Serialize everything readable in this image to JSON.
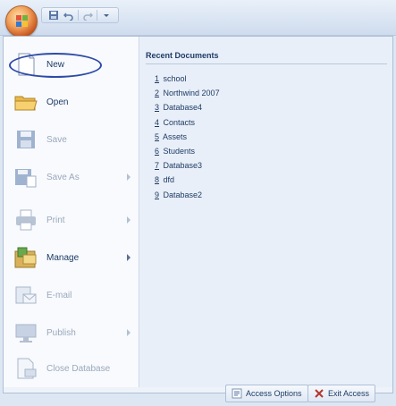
{
  "quick_access": {
    "items": [
      "save-icon",
      "undo-icon",
      "redo-icon",
      "customize-dropdown-icon"
    ]
  },
  "office_button": {
    "icon": "office-logo-icon"
  },
  "left_menu": {
    "items": [
      {
        "label": "New",
        "icon": "new-document-icon",
        "enabled": true,
        "submenu": false
      },
      {
        "label": "Open",
        "icon": "open-folder-icon",
        "enabled": true,
        "submenu": false
      },
      {
        "label": "Save",
        "icon": "save-disk-icon",
        "enabled": false,
        "submenu": false
      },
      {
        "label": "Save As",
        "icon": "save-as-icon",
        "enabled": false,
        "submenu": true
      },
      {
        "label": "Print",
        "icon": "printer-icon",
        "enabled": false,
        "submenu": true
      },
      {
        "label": "Manage",
        "icon": "manage-icon",
        "enabled": true,
        "submenu": true
      },
      {
        "label": "E-mail",
        "icon": "email-icon",
        "enabled": false,
        "submenu": false
      },
      {
        "label": "Publish",
        "icon": "publish-icon",
        "enabled": false,
        "submenu": true
      },
      {
        "label": "Close Database",
        "icon": "close-database-icon",
        "enabled": false,
        "submenu": false
      }
    ]
  },
  "recent": {
    "title": "Recent Documents",
    "items": [
      {
        "num": "1",
        "name": "school"
      },
      {
        "num": "2",
        "name": "Northwind 2007"
      },
      {
        "num": "3",
        "name": "Database4"
      },
      {
        "num": "4",
        "name": "Contacts"
      },
      {
        "num": "5",
        "name": "Assets"
      },
      {
        "num": "6",
        "name": "Students"
      },
      {
        "num": "7",
        "name": "Database3"
      },
      {
        "num": "8",
        "name": "dfd"
      },
      {
        "num": "9",
        "name": "Database2"
      }
    ]
  },
  "bottom": {
    "options_label": "Access Options",
    "exit_label": "Exit Access"
  },
  "colors": {
    "accent": "#2d4aa8",
    "menu_bg": "#eef3fa",
    "text": "#1e3b66",
    "disabled_text": "#9aa8bc"
  }
}
